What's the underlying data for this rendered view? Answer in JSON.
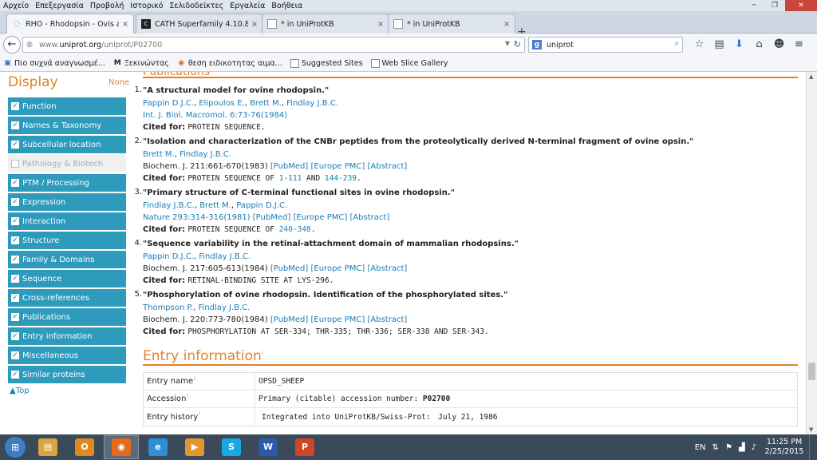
{
  "menu": [
    "Αρχείο",
    "Επεξεργασία",
    "Προβολή",
    "Ιστορικό",
    "Σελιδοδείκτες",
    "Εργαλεία",
    "Βοήθεια"
  ],
  "window_controls": {
    "minimize": "─",
    "maximize": "❐",
    "close": "✕"
  },
  "tabs": [
    {
      "label": "RHO - Rhodopsin - Ovis ari...",
      "close": "×"
    },
    {
      "label": "CATH Superfamily 4.10.840...",
      "close": "×"
    },
    {
      "label": "* in UniProtKB",
      "close": "×"
    },
    {
      "label": "* in UniProtKB",
      "close": "×"
    }
  ],
  "new_tab": "+",
  "nav": {
    "back": "←",
    "url_host": "www.",
    "url_domain": "uniprot.org",
    "url_path": "/uniprot/P02700",
    "search_engine": "g",
    "search_value": "uniprot"
  },
  "bookmarks": [
    {
      "label": "Πιο συχνά αναγνωσμέ...",
      "icon": "folder-icon"
    },
    {
      "label": "Ξεκινώντας",
      "icon": "m-logo-icon"
    },
    {
      "label": "θεση ειδικοτητας αιμα...",
      "icon": "firefox-icon"
    },
    {
      "label": "Suggested Sites",
      "icon": "page-icon"
    },
    {
      "label": "Web Slice Gallery",
      "icon": "page-icon"
    }
  ],
  "sidebar": {
    "title": "Display",
    "none": "None",
    "items": [
      {
        "label": "Function",
        "checked": true
      },
      {
        "label": "Names & Taxonomy",
        "checked": true
      },
      {
        "label": "Subcellular location",
        "checked": true
      },
      {
        "label": "Pathology & Biotech",
        "checked": false
      },
      {
        "label": "PTM / Processing",
        "checked": true
      },
      {
        "label": "Expression",
        "checked": true
      },
      {
        "label": "Interaction",
        "checked": true
      },
      {
        "label": "Structure",
        "checked": true
      },
      {
        "label": "Family & Domains",
        "checked": true
      },
      {
        "label": "Sequence",
        "checked": true
      },
      {
        "label": "Cross-references",
        "checked": true
      },
      {
        "label": "Publications",
        "checked": true
      },
      {
        "label": "Entry information",
        "checked": true
      },
      {
        "label": "Miscellaneous",
        "checked": true
      },
      {
        "label": "Similar proteins",
        "checked": true
      }
    ],
    "top": "Top"
  },
  "publications": {
    "heading": "Publications",
    "items": [
      {
        "num": "1.",
        "title": "\"A structural model for ovine rhodopsin.\"",
        "authors": [
          "Pappin D.J.C.",
          "Elipoulos E.",
          "Brett M.",
          "Findlay J.B.C."
        ],
        "journal": "Int. J. Biol. Macromol. 6:73-76(1984)",
        "journal_linked": true,
        "pubmed": "",
        "europepmc": "",
        "abstract": "",
        "cited": "PROTEIN SEQUENCE."
      },
      {
        "num": "2.",
        "title": "\"Isolation and characterization of the CNBr peptides from the proteolytically derived N-terminal fragment of ovine opsin.\"",
        "authors": [
          "Brett M.",
          "Findlay J.B.C."
        ],
        "journal": "Biochem. J. 211:661-670(1983)",
        "journal_linked": false,
        "pubmed": "[PubMed]",
        "europepmc": "[Europe PMC]",
        "abstract": "[Abstract]",
        "cited_pre": "PROTEIN SEQUENCE OF ",
        "cited_r1": "1-111",
        "cited_mid": " AND ",
        "cited_r2": "144-239",
        "cited_post": "."
      },
      {
        "num": "3.",
        "title": "\"Primary structure of C-terminal functional sites in ovine rhodopsin.\"",
        "authors": [
          "Findlay J.B.C.",
          "Brett M.",
          "Pappin D.J.C."
        ],
        "journal": "Nature 293:314-316(1981)",
        "journal_linked": true,
        "pubmed": "[PubMed]",
        "europepmc": "[Europe PMC]",
        "abstract": "[Abstract]",
        "cited_pre": "PROTEIN SEQUENCE OF ",
        "cited_r1": "240-348",
        "cited_post": "."
      },
      {
        "num": "4.",
        "title": "\"Sequence variability in the retinal-attachment domain of mammalian rhodopsins.\"",
        "authors": [
          "Pappin D.J.C.",
          "Findlay J.B.C."
        ],
        "journal": "Biochem. J. 217:605-613(1984)",
        "journal_linked": false,
        "pubmed": "[PubMed]",
        "europepmc": "[Europe PMC]",
        "abstract": "[Abstract]",
        "cited": "RETINAL-BINDING SITE AT LYS-296."
      },
      {
        "num": "5.",
        "title": "\"Phosphorylation of ovine rhodopsin. Identification of the phosphorylated sites.\"",
        "authors": [
          "Thompson P.",
          "Findlay J.B.C."
        ],
        "journal": "Biochem. J. 220:773-780(1984)",
        "journal_linked": false,
        "pubmed": "[PubMed]",
        "europepmc": "[Europe PMC]",
        "abstract": "[Abstract]",
        "cited": "PHOSPHORYLATION AT SER-334; THR-335; THR-336; SER-338 AND SER-343."
      }
    ],
    "cited_label": "Cited for:"
  },
  "entry_info": {
    "title": "Entry information",
    "info_mark": "i",
    "rows": [
      {
        "key": "Entry name",
        "value": "OPSD_SHEEP"
      },
      {
        "key": "Accession",
        "value_pre": "Primary (citable) accession number: ",
        "value_bold": "P02700"
      },
      {
        "key": "Entry history",
        "value_label": "Integrated into UniProtKB/Swiss-Prot:",
        "value_date": "July 21, 1986"
      }
    ]
  },
  "taskbar": {
    "apps": [
      {
        "name": "explorer",
        "glyph": "▤",
        "color": "#d9a441"
      },
      {
        "name": "outlook",
        "glyph": "O",
        "color": "#e08a1e"
      },
      {
        "name": "firefox",
        "glyph": "◉",
        "color": "#e66a1a"
      },
      {
        "name": "internet-explorer",
        "glyph": "e",
        "color": "#2e8fd8"
      },
      {
        "name": "media-player",
        "glyph": "▶",
        "color": "#e5962b"
      },
      {
        "name": "skype",
        "glyph": "S",
        "color": "#17a9e3"
      },
      {
        "name": "word",
        "glyph": "W",
        "color": "#2a5aa8"
      },
      {
        "name": "powerpoint",
        "glyph": "P",
        "color": "#d04525"
      }
    ],
    "lang": "EN",
    "time": "11:25 PM",
    "date": "2/25/2015"
  }
}
